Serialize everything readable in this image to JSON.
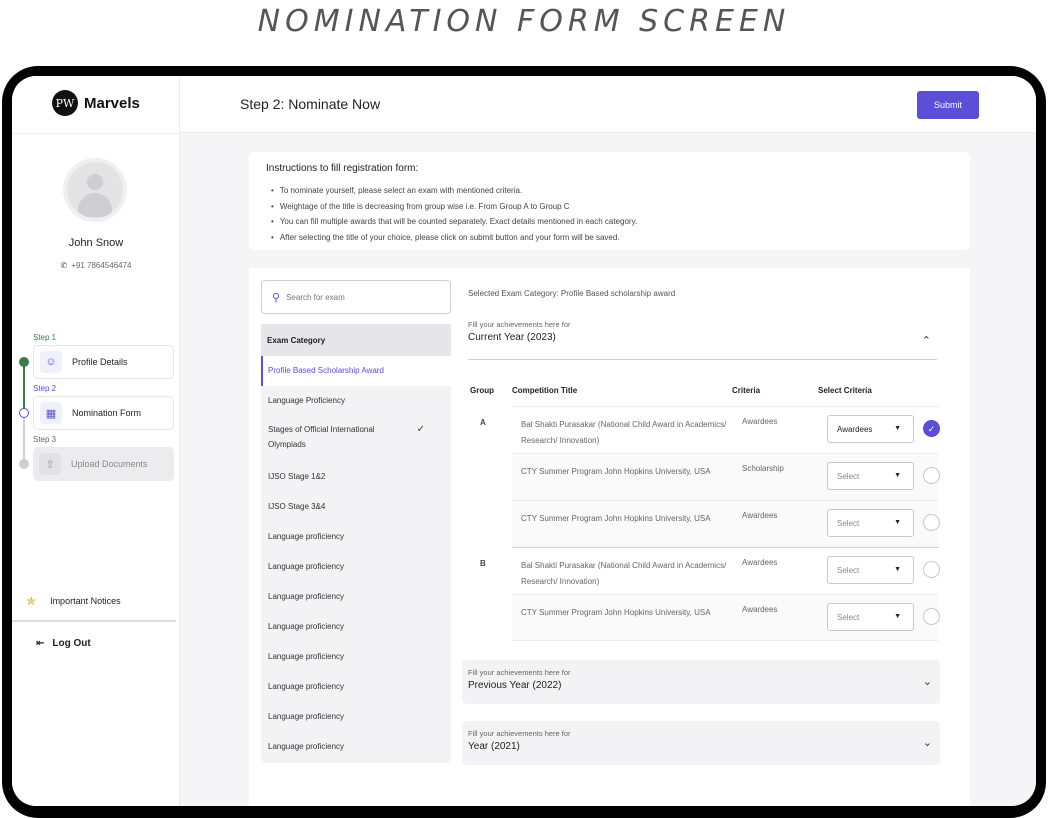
{
  "caption": "NOMINATION FORM SCREEN",
  "brand": {
    "logo_mark": "PW",
    "name": "Marvels"
  },
  "user": {
    "name": "John Snow",
    "phone": "+91 7864546474"
  },
  "steps": [
    {
      "step_label": "Step 1",
      "label": "Profile Details",
      "status": "done"
    },
    {
      "step_label": "Step 2",
      "label": "Nomination Form",
      "status": "active"
    },
    {
      "step_label": "Step 3",
      "label": "Upload Documents",
      "status": "disabled"
    }
  ],
  "sidebar": {
    "notices": "Important Notices",
    "logout": "Log Out"
  },
  "header": {
    "title": "Step 2: Nominate Now",
    "submit_label": "Submit"
  },
  "instructions": {
    "title": "Instructions to fill registration form:",
    "items": [
      "To nominate yourself, please select an exam with mentioned criteria.",
      "Weightage of the title is decreasing from group wise i.e. From Group A to Group C",
      "You can fill multiple awards that will be counted separately. Exact details mentioned in each category.",
      "After selecting the title of your choice, please click on submit button and your form will be saved."
    ]
  },
  "search": {
    "placeholder": "Search for exam"
  },
  "categories": {
    "header": "Exam Category",
    "items": [
      {
        "label": "Profile Based Scholarship Award",
        "selected": true
      },
      {
        "label": "Language Proficiency"
      },
      {
        "label": "Stages of Official International Olympiads",
        "checked": true
      },
      {
        "label": "IJSO Stage 1&2"
      },
      {
        "label": "IJSO Stage 3&4"
      },
      {
        "label": "Language proficiency"
      },
      {
        "label": "Language proficiency"
      },
      {
        "label": "Language proficiency"
      },
      {
        "label": "Language proficiency"
      },
      {
        "label": "Language proficiency"
      },
      {
        "label": "Language proficiency"
      },
      {
        "label": "Language proficiency"
      },
      {
        "label": "Language proficiency"
      }
    ]
  },
  "selected_category": "Selected Exam Category: Profile Based scholarship award",
  "sections": {
    "current": {
      "sub": "Fill your achievements here for",
      "title": "Current Year (2023)"
    },
    "previous": {
      "sub": "Fill your achievements here for",
      "title": "Previous Year (2022)"
    },
    "year2021": {
      "sub": "Fill your achievements here for",
      "title": "Year (2021)"
    }
  },
  "table": {
    "columns": [
      "Group",
      "Competition Title",
      "Criteria",
      "Select Criteria"
    ],
    "rows": [
      {
        "group": "A",
        "title": "Bal Shakti Purasakar (National Child Award in Academics/ Research/ Innovation)",
        "criteria": "Awardees",
        "select": "Awardees",
        "selected": true
      },
      {
        "group": "",
        "title": "CTY Summer Program John Hopkins University, USA",
        "criteria": "Scholarship",
        "select": "Select",
        "selected": false
      },
      {
        "group": "",
        "title": "CTY Summer Program John Hopkins University, USA",
        "criteria": "Awardees",
        "select": "Select",
        "selected": false
      },
      {
        "group": "B",
        "title": "Bal Shakti Purasakar (National Child Award in Academics/ Research/ Innovation)",
        "criteria": "Awardees",
        "select": "Select",
        "selected": false
      },
      {
        "group": "",
        "title": "CTY Summer Program John Hopkins University, USA",
        "criteria": "Awardees",
        "select": "Select",
        "selected": false
      }
    ]
  },
  "colors": {
    "accent": "#5a4fd6",
    "done": "#3d7a4a"
  }
}
